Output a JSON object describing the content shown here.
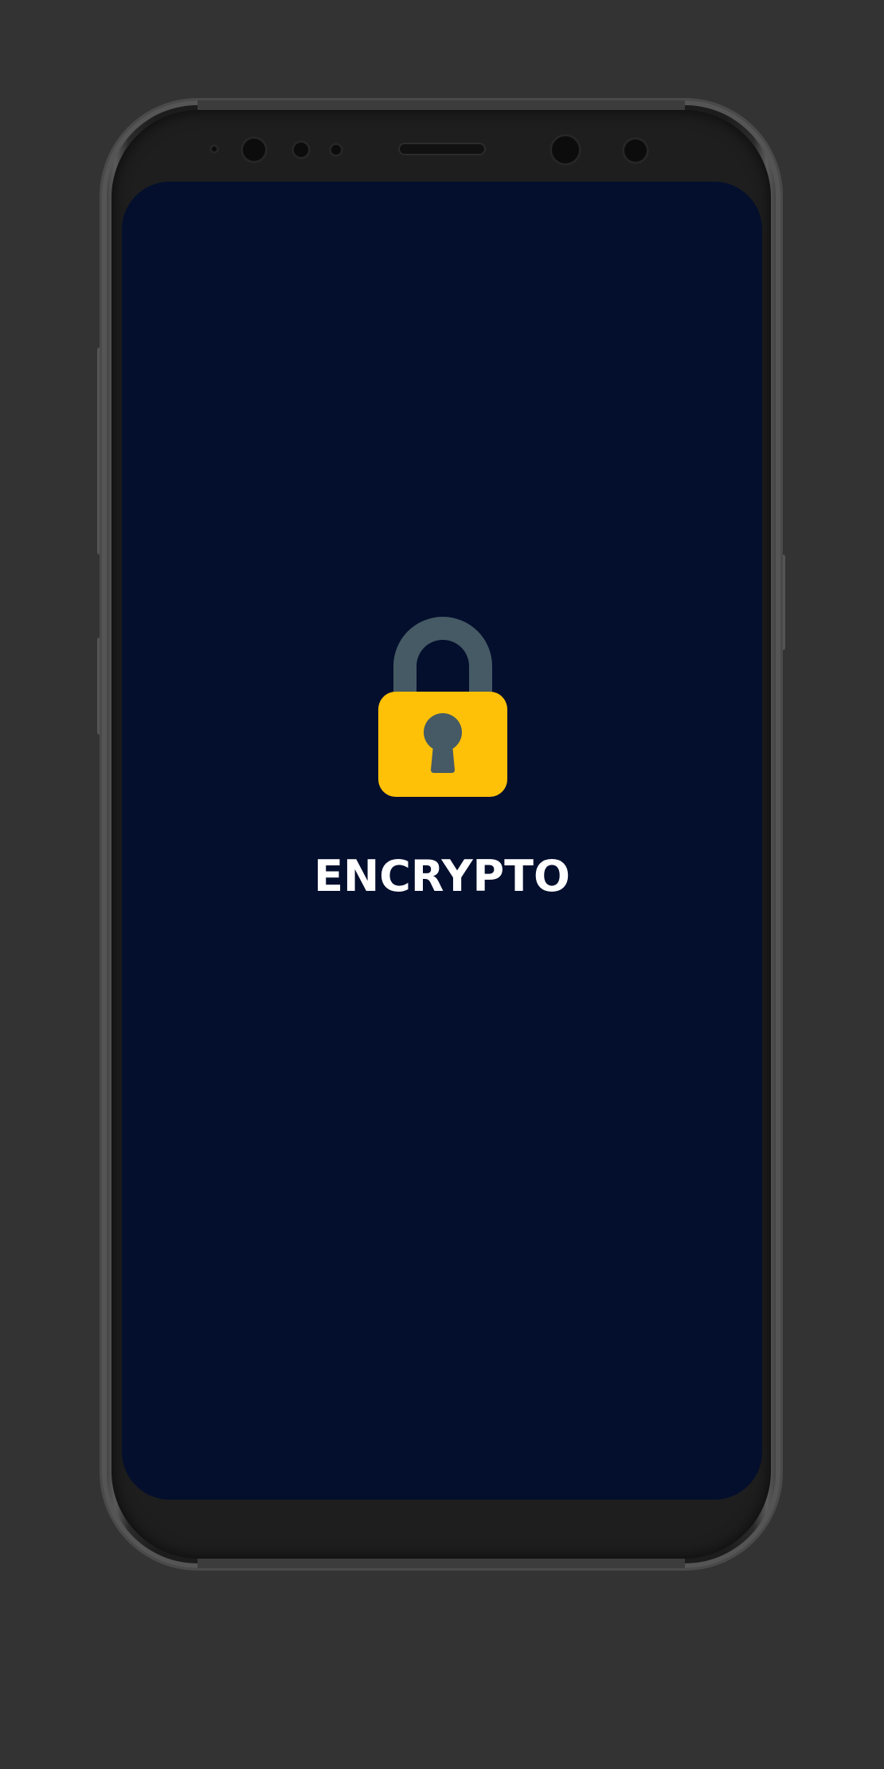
{
  "app": {
    "title": "ENCRYPTO"
  },
  "icons": {
    "logo": "padlock-icon"
  },
  "colors": {
    "page_background": "#333333",
    "screen_background": "#040f2d",
    "lock_body": "#ffc107",
    "lock_shackle": "#455a64",
    "keyhole": "#455a64",
    "title_text": "#ffffff"
  }
}
